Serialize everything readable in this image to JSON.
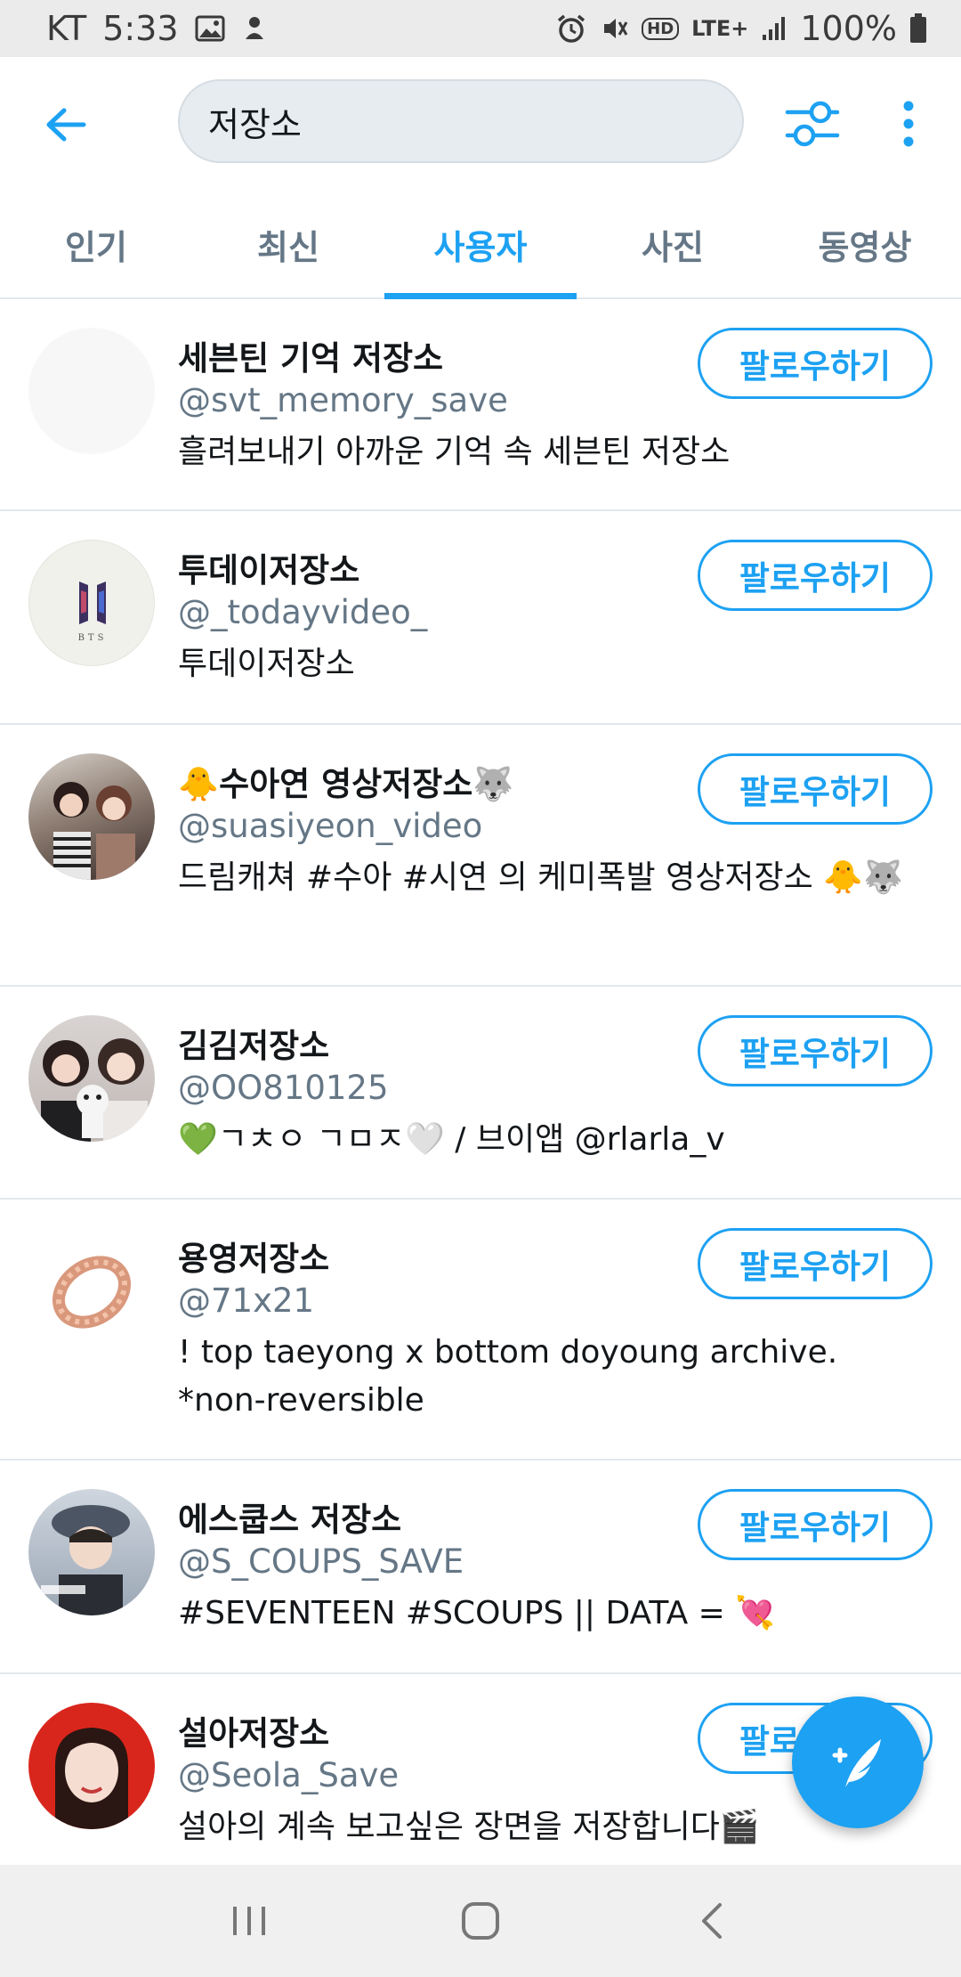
{
  "status_bar": {
    "carrier": "KT",
    "time": "5:33",
    "network_label": "LTE+",
    "hd_label": "HD",
    "battery": "100%"
  },
  "header": {
    "search_value": "저장소"
  },
  "tabs": [
    {
      "label": "인기",
      "active": false
    },
    {
      "label": "최신",
      "active": false
    },
    {
      "label": "사용자",
      "active": true
    },
    {
      "label": "사진",
      "active": false
    },
    {
      "label": "동영상",
      "active": false
    }
  ],
  "users": [
    {
      "name": "세븐틴 기억 저장소",
      "handle": "@svt_memory_save",
      "bio": "흘려보내기 아까운 기억 속 세븐틴 저장소",
      "follow_label": "팔로우하기",
      "avatar": "blank-avatar"
    },
    {
      "name": "투데이저장소",
      "handle": "@_todayvideo_",
      "bio": "투데이저장소",
      "follow_label": "팔로우하기",
      "avatar": "bts-logo-avatar"
    },
    {
      "name": "🐥수아연 영상저장소🐺",
      "handle": "@suasiyeon_video",
      "bio": "드림캐쳐 #수아 #시연 의 케미폭발 영상저장소 🐥🐺",
      "follow_label": "팔로우하기",
      "avatar": "two-girls-photo-avatar"
    },
    {
      "name": "김김저장소",
      "handle": "@OO810125",
      "bio": "💚ㄱㅊㅇ ㄱㅁㅈ🤍 / 브이앱 @rlarla_v",
      "follow_label": "팔로우하기",
      "avatar": "girls-with-plush-avatar"
    },
    {
      "name": "용영저장소",
      "handle": "@71x21",
      "bio": "! top taeyong x bottom doyoung archive. *non-reversible",
      "follow_label": "팔로우하기",
      "avatar": "ring-avatar"
    },
    {
      "name": "에스쿱스 저장소",
      "handle": "@S_COUPS_SAVE",
      "bio": "#SEVENTEEN #SCOUPS || DATA = 💘",
      "follow_label": "팔로우하기",
      "avatar": "boy-in-beret-avatar"
    },
    {
      "name": "설아저장소",
      "handle": "@Seola_Save",
      "bio": "설아의 계속 보고싶은 장면을 저장합니다🎬",
      "follow_label": "팔로우하기",
      "avatar": "girl-red-background-avatar"
    }
  ],
  "colors": {
    "accent": "#1da1f2",
    "text_primary": "#14171a",
    "text_secondary": "#657786",
    "divider": "#e1e8ed"
  },
  "icons": {
    "back": "arrow-left-icon",
    "filter": "sliders-icon",
    "more": "vertical-dots-icon",
    "fab": "compose-feather-icon",
    "nav_recents": "recents-icon",
    "nav_home": "home-icon",
    "nav_back": "nav-back-icon"
  }
}
